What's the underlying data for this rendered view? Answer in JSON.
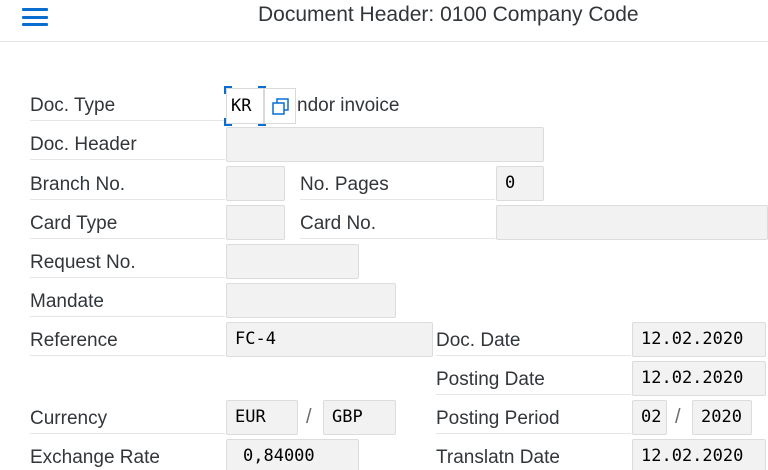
{
  "header": {
    "title": "Document Header: 0100 Company Code"
  },
  "form": {
    "doc_type": {
      "label": "Doc. Type",
      "value": "KR",
      "description_visible": "ndor invoice"
    },
    "doc_header": {
      "label": "Doc. Header",
      "value": ""
    },
    "branch_no": {
      "label": "Branch No.",
      "value": ""
    },
    "no_pages": {
      "label": "No. Pages",
      "value": "0"
    },
    "card_type": {
      "label": "Card Type",
      "value": ""
    },
    "card_no": {
      "label": "Card No.",
      "value": ""
    },
    "request_no": {
      "label": "Request No.",
      "value": ""
    },
    "mandate": {
      "label": "Mandate",
      "value": ""
    },
    "reference": {
      "label": "Reference",
      "value": "FC-4"
    },
    "doc_date": {
      "label": "Doc. Date",
      "value": "12.02.2020"
    },
    "posting_date": {
      "label": "Posting Date",
      "value": "12.02.2020"
    },
    "currency": {
      "label": "Currency",
      "value": "EUR",
      "second_value": "GBP",
      "separator": "/"
    },
    "posting_period": {
      "label": "Posting Period",
      "period": "02",
      "year": "2020",
      "separator": "/"
    },
    "exchange_rate": {
      "label": "Exchange Rate",
      "value": "0,84000"
    },
    "translatn_date": {
      "label": "Translatn Date",
      "value": "12.02.2020"
    }
  },
  "colors": {
    "accent": "#0a6ed1",
    "field_bg": "#f2f2f2",
    "text": "#32363a"
  }
}
